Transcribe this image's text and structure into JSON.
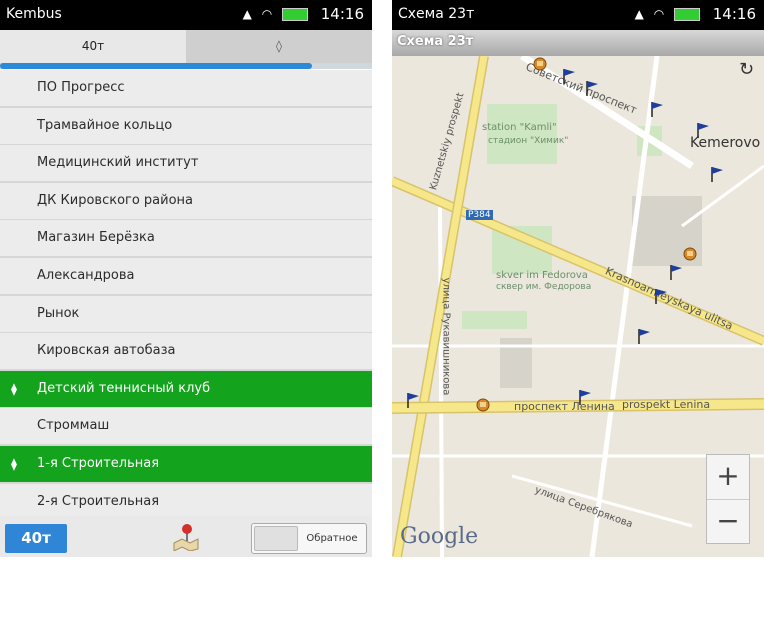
{
  "left_screen": {
    "app_title": "Kembus",
    "clock": "14:16",
    "tabs": [
      {
        "label": "40т"
      },
      {
        "label": "◊"
      }
    ],
    "progress_fraction": 0.84,
    "stops": [
      {
        "name": "ПО Прогресс",
        "highlighted": false
      },
      {
        "name": "Трамвайное кольцо",
        "highlighted": false
      },
      {
        "name": "Медицинский институт",
        "highlighted": false
      },
      {
        "name": "ДК Кировского района",
        "highlighted": false
      },
      {
        "name": "Магазин Берёзка",
        "highlighted": false
      },
      {
        "name": "Александрова",
        "highlighted": false
      },
      {
        "name": "Рынок",
        "highlighted": false
      },
      {
        "name": "Кировская автобаза",
        "highlighted": false
      },
      {
        "name": "Детский теннисный клуб",
        "highlighted": true
      },
      {
        "name": "Строммаш",
        "highlighted": false
      },
      {
        "name": "1-я Строительная",
        "highlighted": true
      },
      {
        "name": "2-я Строительная",
        "highlighted": false
      }
    ],
    "route_button": "40т",
    "direction_switch": "Обратное"
  },
  "right_screen": {
    "app_title": "Схема 23т",
    "clock": "14:16",
    "map_header": "Схема 23т",
    "map_labels": {
      "city": "Kemerovo",
      "street_sovetsky": "Советский проспект",
      "street_kuznetsky": "Kuznetskiy prospekt",
      "station": "station \"Kamli\"",
      "station_sub": "стадион \"Химик\"",
      "road_number": "Р384",
      "square": "skver im Fedorova",
      "square_sub": "сквер им. Федорова",
      "street_krasnoarmeyskaya": "Krasnoarmeyskaya ulitsa",
      "street_rukavishnikova": "улица Рукавишникова",
      "street_lenina_ru": "проспект Ленина",
      "street_lenina_en": "prospekt Lenina",
      "street_serebryakova": "улица Серебрякова",
      "google": "Google"
    },
    "zoom_in": "+",
    "zoom_out": "−",
    "refresh_symbol": "↻"
  },
  "colors": {
    "highlight": "#13a31c",
    "accent": "#2f86d6",
    "road": "#f6e88a"
  }
}
